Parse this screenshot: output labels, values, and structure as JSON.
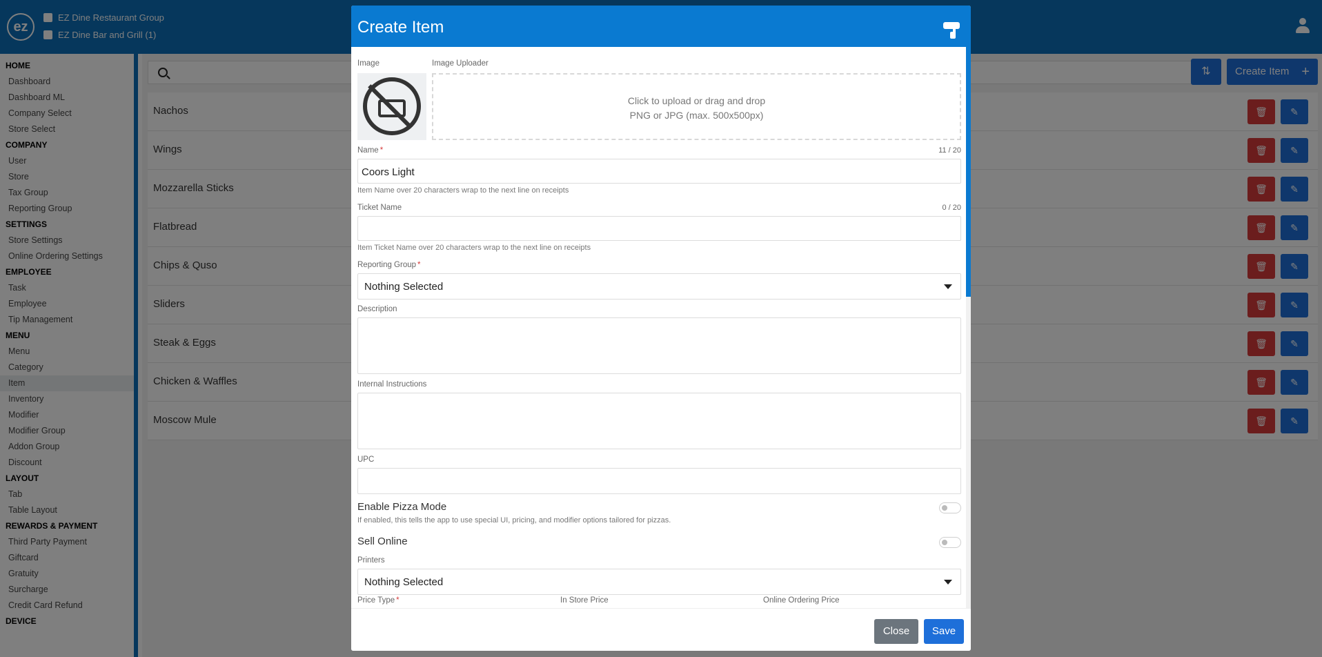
{
  "header": {
    "logo": "ez",
    "company": "EZ Dine Restaurant Group",
    "store": "EZ Dine Bar and Grill (1)"
  },
  "sidebar": {
    "sections": [
      {
        "title": "HOME",
        "items": [
          "Dashboard",
          "Dashboard ML",
          "Company Select",
          "Store Select"
        ]
      },
      {
        "title": "COMPANY",
        "items": [
          "User",
          "Store",
          "Tax Group",
          "Reporting Group"
        ]
      },
      {
        "title": "SETTINGS",
        "items": [
          "Store Settings",
          "Online Ordering Settings"
        ]
      },
      {
        "title": "EMPLOYEE",
        "items": [
          "Task",
          "Employee",
          "Tip Management"
        ]
      },
      {
        "title": "MENU",
        "items": [
          "Menu",
          "Category",
          "Item",
          "Inventory",
          "Modifier",
          "Modifier Group",
          "Addon Group",
          "Discount"
        ]
      },
      {
        "title": "LAYOUT",
        "items": [
          "Tab",
          "Table Layout"
        ]
      },
      {
        "title": "REWARDS & PAYMENT",
        "items": [
          "Third Party Payment",
          "Giftcard",
          "Gratuity",
          "Surcharge",
          "Credit Card Refund"
        ]
      },
      {
        "title": "DEVICE",
        "items": []
      }
    ],
    "active_item": "Item"
  },
  "toolbar": {
    "create_label": "Create Item"
  },
  "items": [
    "Nachos",
    "Wings",
    "Mozzarella Sticks",
    "Flatbread",
    "Chips & Quso",
    "Sliders",
    "Steak & Eggs",
    "Chicken & Waffles",
    "Moscow Mule"
  ],
  "modal": {
    "title": "Create Item",
    "image_label": "Image",
    "uploader_label": "Image Uploader",
    "uploader_line1": "Click to upload or drag and drop",
    "uploader_line2": "PNG or JPG (max. 500x500px)",
    "name_label": "Name",
    "name_value": "Coors Light",
    "name_counter": "11 / 20",
    "name_hint": "Item Name over 20 characters wrap to the next line on receipts",
    "ticket_label": "Ticket Name",
    "ticket_value": "",
    "ticket_counter": "0 / 20",
    "ticket_hint": "Item Ticket Name over 20 characters wrap to the next line on receipts",
    "reporting_label": "Reporting Group",
    "reporting_value": "Nothing Selected",
    "description_label": "Description",
    "internal_label": "Internal Instructions",
    "upc_label": "UPC",
    "pizza_label": "Enable Pizza Mode",
    "pizza_hint": "If enabled, this tells the app to use special UI, pricing, and modifier options tailored for pizzas.",
    "pizza_enabled": false,
    "sell_online_label": "Sell Online",
    "sell_online_enabled": false,
    "printers_label": "Printers",
    "printers_value": "Nothing Selected",
    "price_type_label": "Price Type",
    "in_store_price_label": "In Store Price",
    "online_price_label": "Online Ordering Price",
    "close_label": "Close",
    "save_label": "Save"
  },
  "colors": {
    "brand": "#0d6fb8",
    "modal_header": "#0a7ad1",
    "primary": "#1e6fd9",
    "danger": "#d63a3a",
    "secondary": "#6c757d"
  }
}
